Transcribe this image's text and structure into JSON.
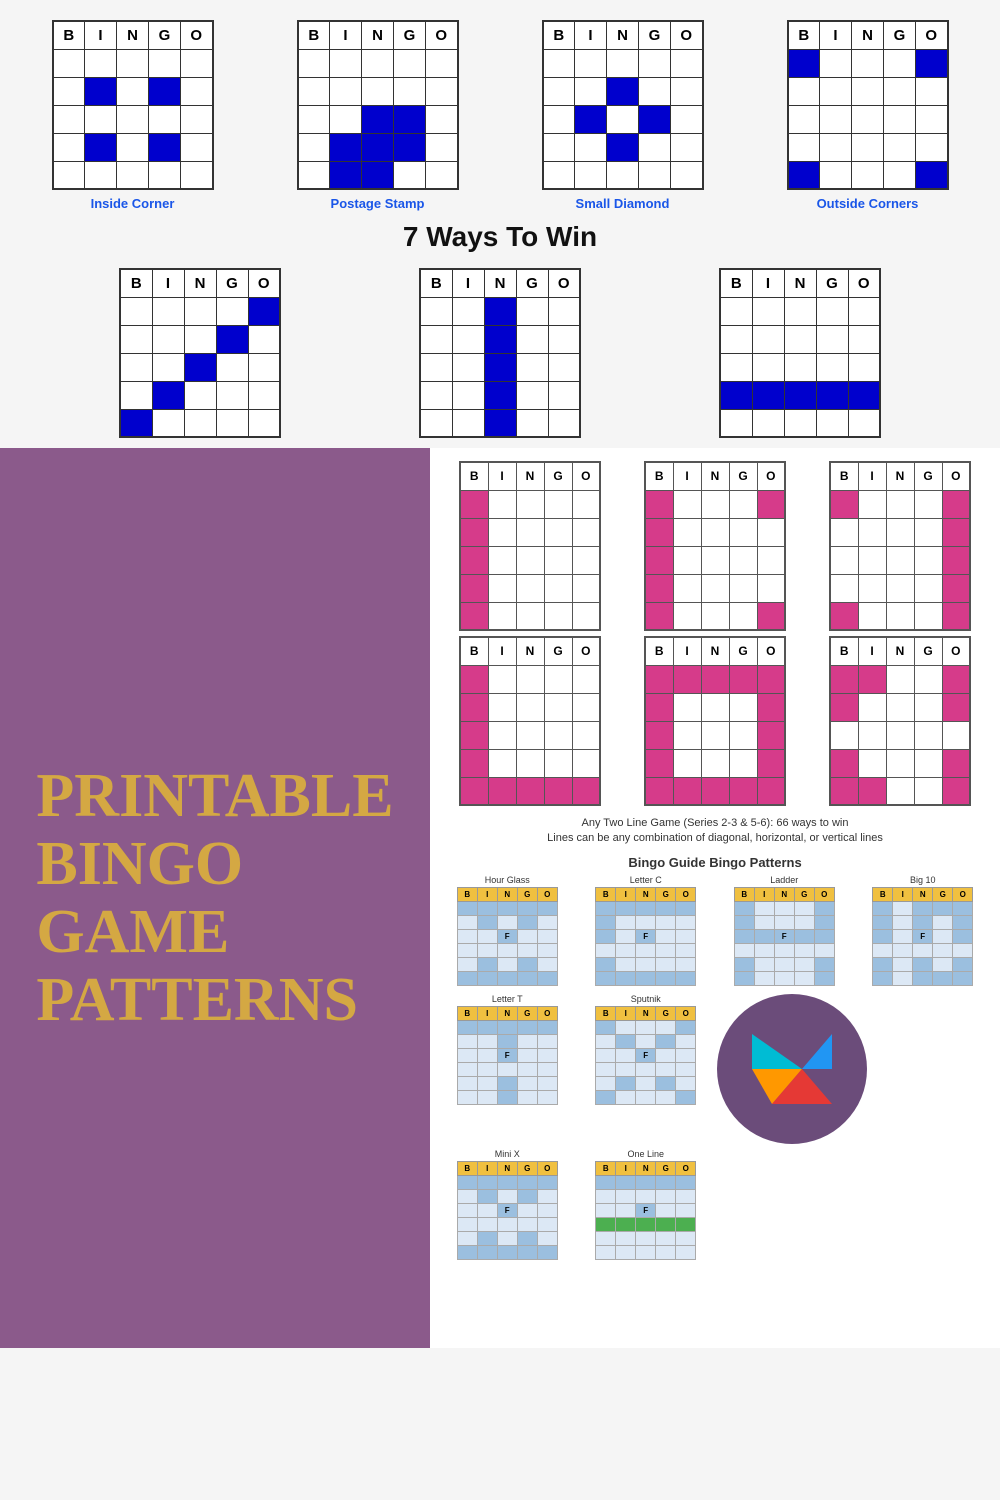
{
  "topCards": [
    {
      "label": "Inside Corner",
      "pattern": [
        [
          0,
          0,
          0,
          0,
          0
        ],
        [
          0,
          1,
          0,
          1,
          0
        ],
        [
          0,
          0,
          0,
          0,
          0
        ],
        [
          0,
          1,
          0,
          1,
          0
        ],
        [
          0,
          0,
          0,
          0,
          0
        ]
      ]
    },
    {
      "label": "Postage Stamp",
      "pattern": [
        [
          0,
          0,
          0,
          0,
          0
        ],
        [
          0,
          0,
          0,
          0,
          0
        ],
        [
          0,
          0,
          1,
          1,
          0
        ],
        [
          0,
          1,
          1,
          1,
          0
        ],
        [
          0,
          1,
          1,
          0,
          0
        ]
      ]
    },
    {
      "label": "Small Diamond",
      "pattern": [
        [
          0,
          0,
          0,
          0,
          0
        ],
        [
          0,
          0,
          1,
          0,
          0
        ],
        [
          0,
          1,
          0,
          1,
          0
        ],
        [
          0,
          0,
          1,
          0,
          0
        ],
        [
          0,
          0,
          0,
          0,
          0
        ]
      ]
    },
    {
      "label": "Outside Corners",
      "pattern": [
        [
          1,
          0,
          0,
          0,
          1
        ],
        [
          0,
          0,
          0,
          0,
          0
        ],
        [
          0,
          0,
          0,
          0,
          0
        ],
        [
          0,
          0,
          0,
          0,
          0
        ],
        [
          1,
          0,
          0,
          0,
          1
        ]
      ]
    }
  ],
  "waysTitle": "7 Ways To Win",
  "middleCards": [
    {
      "pattern": [
        [
          0,
          0,
          0,
          0,
          1
        ],
        [
          0,
          0,
          0,
          1,
          0
        ],
        [
          0,
          0,
          1,
          0,
          0
        ],
        [
          0,
          1,
          0,
          0,
          0
        ],
        [
          1,
          0,
          0,
          0,
          0
        ]
      ]
    },
    {
      "pattern": [
        [
          0,
          0,
          1,
          0,
          0
        ],
        [
          0,
          0,
          1,
          0,
          0
        ],
        [
          0,
          0,
          1,
          0,
          0
        ],
        [
          0,
          0,
          1,
          0,
          0
        ],
        [
          0,
          0,
          1,
          0,
          0
        ]
      ]
    },
    {
      "pattern": [
        [
          0,
          0,
          0,
          0,
          0
        ],
        [
          0,
          0,
          0,
          0,
          0
        ],
        [
          0,
          0,
          0,
          0,
          0
        ],
        [
          1,
          1,
          1,
          1,
          1
        ],
        [
          0,
          0,
          0,
          0,
          0
        ]
      ]
    }
  ],
  "purpleTitle": "PRINTABLE\nBINGO\nGAME\nPATTERNS",
  "pinkCards": [
    {
      "pattern": [
        [
          1,
          0,
          0,
          0,
          0
        ],
        [
          1,
          0,
          0,
          0,
          0
        ],
        [
          1,
          0,
          0,
          0,
          0
        ],
        [
          1,
          0,
          0,
          0,
          0
        ],
        [
          1,
          0,
          0,
          0,
          0
        ]
      ]
    },
    {
      "pattern": [
        [
          1,
          0,
          0,
          0,
          1
        ],
        [
          1,
          0,
          0,
          0,
          0
        ],
        [
          1,
          0,
          0,
          0,
          0
        ],
        [
          1,
          0,
          0,
          0,
          0
        ],
        [
          1,
          0,
          0,
          0,
          1
        ]
      ]
    },
    {
      "pattern": [
        [
          1,
          0,
          0,
          0,
          1
        ],
        [
          0,
          0,
          0,
          0,
          1
        ],
        [
          0,
          0,
          0,
          0,
          1
        ],
        [
          0,
          0,
          0,
          0,
          1
        ],
        [
          1,
          0,
          0,
          0,
          1
        ]
      ]
    },
    {
      "pattern": [
        [
          1,
          0,
          0,
          0,
          0
        ],
        [
          1,
          0,
          0,
          0,
          0
        ],
        [
          1,
          0,
          0,
          0,
          0
        ],
        [
          1,
          0,
          0,
          0,
          0
        ],
        [
          1,
          1,
          1,
          1,
          1
        ]
      ]
    },
    {
      "pattern": [
        [
          1,
          1,
          1,
          1,
          1
        ],
        [
          1,
          0,
          0,
          0,
          1
        ],
        [
          1,
          0,
          0,
          0,
          1
        ],
        [
          1,
          0,
          0,
          0,
          1
        ],
        [
          1,
          1,
          1,
          1,
          1
        ]
      ]
    },
    {
      "pattern": [
        [
          1,
          1,
          0,
          0,
          1
        ],
        [
          1,
          0,
          0,
          0,
          1
        ],
        [
          0,
          0,
          0,
          0,
          0
        ],
        [
          1,
          0,
          0,
          0,
          1
        ],
        [
          1,
          1,
          0,
          0,
          1
        ]
      ]
    }
  ],
  "twoLineText": "Any Two Line Game (Series 2-3 & 5-6): 66 ways to win\nLines can be any combination of diagonal, horizontal, or vertical lines",
  "bingoGuideTitle": "Bingo Guide",
  "bingoGuideBold": "Bingo Patterns",
  "guideCards": [
    {
      "label": "Hour Glass",
      "hasF": true,
      "fRow": 3,
      "pattern": [
        [
          1,
          1,
          1,
          1,
          1
        ],
        [
          0,
          1,
          0,
          1,
          0
        ],
        [
          0,
          0,
          0,
          0,
          0
        ],
        [
          0,
          0,
          0,
          0,
          0
        ],
        [
          0,
          1,
          0,
          1,
          0
        ],
        [
          1,
          1,
          1,
          1,
          1
        ]
      ]
    },
    {
      "label": "Letter C",
      "hasF": true,
      "fRow": 3,
      "pattern": [
        [
          1,
          1,
          1,
          1,
          1
        ],
        [
          1,
          0,
          0,
          0,
          0
        ],
        [
          1,
          0,
          0,
          0,
          0
        ],
        [
          0,
          0,
          0,
          0,
          0
        ],
        [
          1,
          0,
          0,
          0,
          0
        ],
        [
          1,
          1,
          1,
          1,
          1
        ]
      ]
    },
    {
      "label": "Ladder",
      "hasF": true,
      "fRow": 3,
      "pattern": [
        [
          1,
          0,
          0,
          0,
          1
        ],
        [
          1,
          0,
          0,
          0,
          1
        ],
        [
          1,
          1,
          1,
          1,
          1
        ],
        [
          0,
          0,
          0,
          0,
          0
        ],
        [
          1,
          0,
          0,
          0,
          1
        ],
        [
          1,
          0,
          0,
          0,
          1
        ]
      ]
    },
    {
      "label": "Big 10",
      "hasF": true,
      "fRow": 3,
      "pattern": [
        [
          1,
          0,
          1,
          1,
          1
        ],
        [
          1,
          0,
          1,
          0,
          1
        ],
        [
          1,
          0,
          1,
          0,
          1
        ],
        [
          0,
          0,
          0,
          0,
          0
        ],
        [
          1,
          0,
          1,
          0,
          1
        ],
        [
          1,
          0,
          1,
          1,
          1
        ]
      ]
    }
  ],
  "guideCards2": [
    {
      "label": "Letter T",
      "hasF": true,
      "pattern": [
        [
          1,
          1,
          1,
          1,
          1
        ],
        [
          0,
          0,
          1,
          0,
          0
        ],
        [
          0,
          0,
          1,
          0,
          0
        ],
        [
          0,
          0,
          0,
          0,
          0
        ],
        [
          0,
          0,
          1,
          0,
          0
        ],
        [
          0,
          0,
          1,
          0,
          0
        ]
      ]
    },
    {
      "label": "Sputnik",
      "hasF": true,
      "pattern": [
        [
          1,
          0,
          0,
          0,
          1
        ],
        [
          0,
          1,
          0,
          1,
          0
        ],
        [
          0,
          0,
          0,
          0,
          0
        ],
        [
          0,
          0,
          0,
          0,
          0
        ],
        [
          0,
          1,
          0,
          1,
          0
        ],
        [
          1,
          0,
          0,
          0,
          1
        ]
      ]
    }
  ],
  "guideCards3": [
    {
      "label": "Mini X",
      "hasF": true,
      "pattern": [
        [
          1,
          1,
          1,
          1,
          1
        ],
        [
          0,
          1,
          0,
          1,
          0
        ],
        [
          0,
          0,
          0,
          0,
          0
        ],
        [
          0,
          0,
          0,
          0,
          0
        ],
        [
          0,
          1,
          0,
          1,
          0
        ],
        [
          1,
          1,
          1,
          1,
          1
        ]
      ]
    },
    {
      "label": "One Line",
      "hasF": true,
      "greenRow": 3,
      "pattern": [
        [
          1,
          1,
          1,
          1,
          1
        ],
        [
          0,
          0,
          0,
          0,
          0
        ],
        [
          0,
          0,
          0,
          0,
          0
        ],
        [
          0,
          0,
          0,
          0,
          0
        ],
        [
          0,
          0,
          0,
          0,
          0
        ],
        [
          0,
          0,
          0,
          0,
          0
        ]
      ]
    }
  ]
}
